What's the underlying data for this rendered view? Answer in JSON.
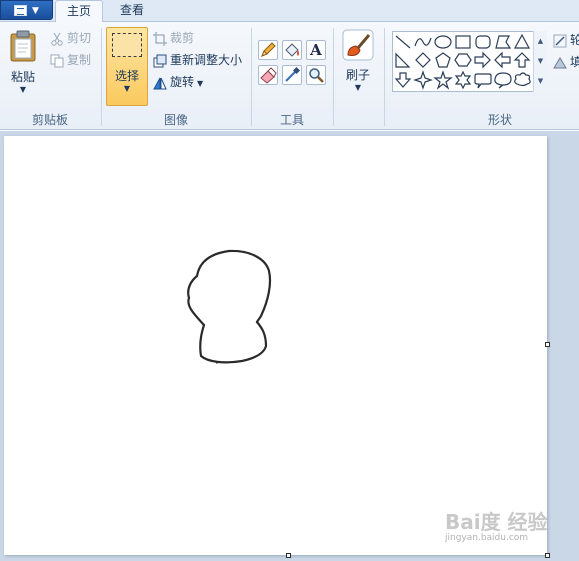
{
  "tabs": [
    {
      "label": "主页",
      "active": true
    },
    {
      "label": "查看",
      "active": false
    }
  ],
  "app_menu_icon": "app-menu-icon",
  "ribbon": {
    "clipboard": {
      "group_label": "剪贴板",
      "paste_label": "粘贴",
      "cut_label": "剪切",
      "copy_label": "复制"
    },
    "image": {
      "group_label": "图像",
      "select_label": "选择",
      "crop_label": "裁剪",
      "resize_label": "重新调整大小",
      "rotate_label": "旋转"
    },
    "tools": {
      "group_label": "工具",
      "items": [
        "pencil-icon",
        "fill-bucket-icon",
        "text-icon",
        "eraser-icon",
        "color-picker-icon",
        "magnifier-icon"
      ],
      "text_glyph": "A"
    },
    "brushes": {
      "label": "刷子"
    },
    "shapes": {
      "group_label": "形状",
      "outline_label": "轮",
      "fill_label": "填"
    }
  },
  "watermark": {
    "logo": "Bai度 经验",
    "url": "jingyan.baidu.com"
  },
  "colors": {
    "select_highlight": "#fcd67a",
    "ribbon_bg": "#f5f8fc",
    "workspace_bg": "#cad7e6",
    "drawing_stroke": "#2a2a2a"
  }
}
